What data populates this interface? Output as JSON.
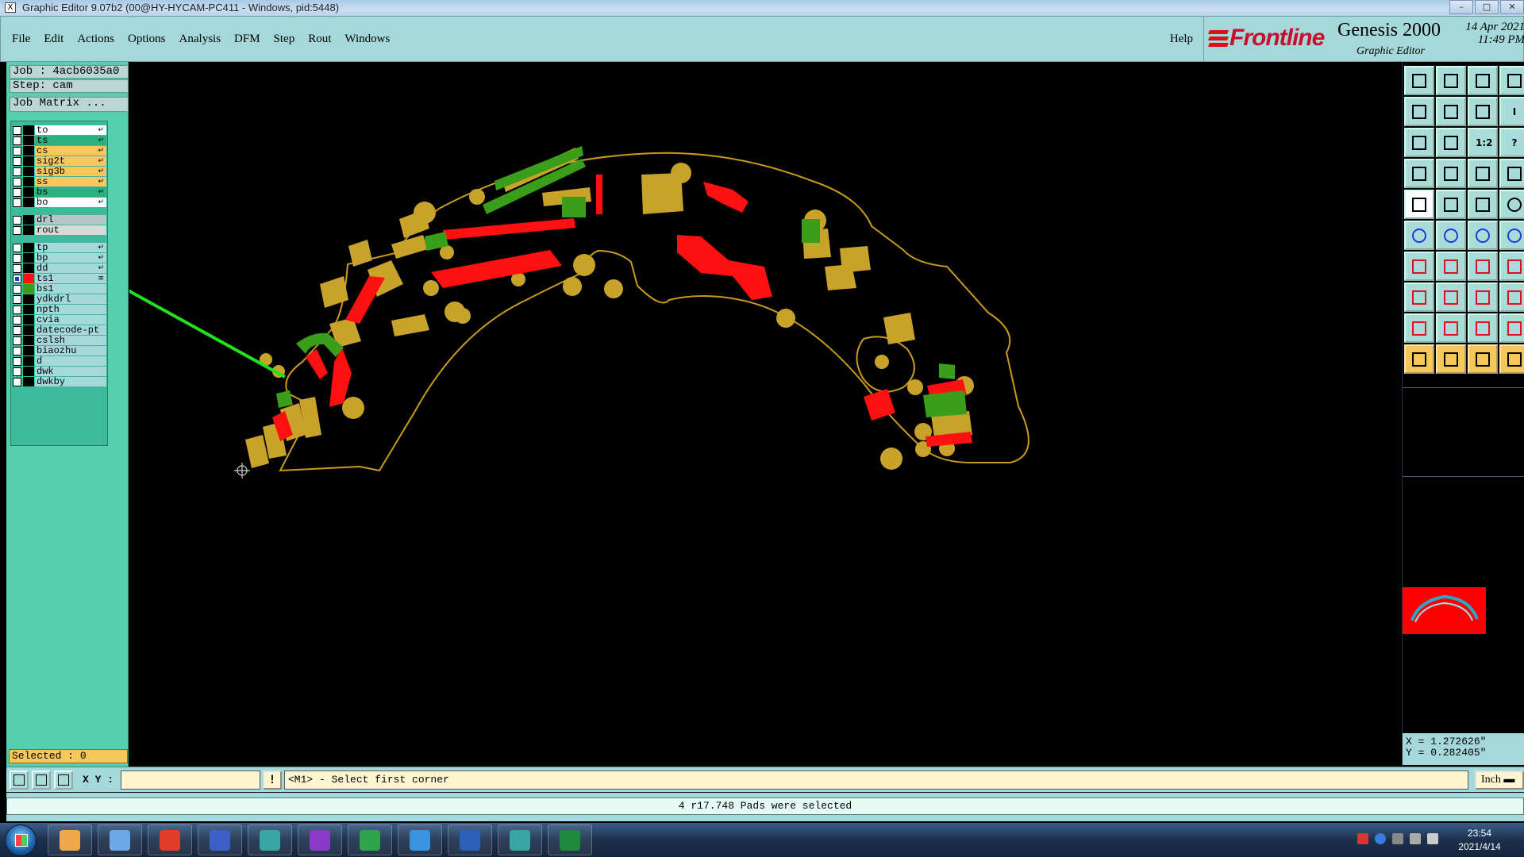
{
  "window": {
    "title": "Graphic Editor 9.07b2 (00@HY-HYCAM-PC411 - Windows, pid:5448)",
    "app_icon": "X",
    "buttons": [
      "–",
      "□",
      "✕"
    ]
  },
  "menu": {
    "items": [
      "File",
      "Edit",
      "Actions",
      "Options",
      "Analysis",
      "DFM",
      "Step",
      "Rout",
      "Windows"
    ],
    "help": "Help"
  },
  "brand": {
    "logo_text": "Frontline",
    "product": "Genesis 2000",
    "subtitle": "Graphic Editor",
    "date": "14 Apr 2021",
    "time": "11:49 PM"
  },
  "left_panel": {
    "job": "Job : 4acb6035a0",
    "step": "Step: cam",
    "job_matrix": "Job Matrix ...",
    "layers": [
      {
        "name": "to",
        "color": "#ffffff",
        "swatch": "#000000",
        "tick": "↵"
      },
      {
        "name": "ts",
        "color": "#2bb07f",
        "swatch": "#000000",
        "tick": "↵"
      },
      {
        "name": "cs",
        "color": "#f6c75a",
        "swatch": "#000000",
        "tick": "↵"
      },
      {
        "name": "sig2t",
        "color": "#f6c75a",
        "swatch": "#000000",
        "tick": "↵"
      },
      {
        "name": "sig3b",
        "color": "#f6c75a",
        "swatch": "#000000",
        "tick": "↵"
      },
      {
        "name": "ss",
        "color": "#f6c75a",
        "swatch": "#000000",
        "tick": "↵"
      },
      {
        "name": "bs",
        "color": "#2bb07f",
        "swatch": "#000000",
        "tick": "↵"
      },
      {
        "name": "bo",
        "color": "#ffffff",
        "swatch": "#000000",
        "tick": "↵"
      },
      {
        "name": "drl",
        "color": "#b9c5c5",
        "swatch": "#000000",
        "tick": ""
      },
      {
        "name": "rout",
        "color": "#d9d9d9",
        "swatch": "#000000",
        "tick": ""
      },
      {
        "name": "tp",
        "color": "#a5d8da",
        "swatch": "#000000",
        "tick": "↵"
      },
      {
        "name": "bp",
        "color": "#a5d8da",
        "swatch": "#000000",
        "tick": "↵"
      },
      {
        "name": "dd",
        "color": "#a5d8da",
        "swatch": "#000000",
        "tick": "↵"
      },
      {
        "name": "ts1",
        "color": "#a5d8da",
        "swatch": "#ff1010",
        "tick": "≡",
        "checked": true
      },
      {
        "name": "bs1",
        "color": "#a5d8da",
        "swatch": "#3a9e1a",
        "tick": ""
      },
      {
        "name": "ydkdrl",
        "color": "#a5d8da",
        "swatch": "#000000",
        "tick": ""
      },
      {
        "name": "npth",
        "color": "#a5d8da",
        "swatch": "#000000",
        "tick": ""
      },
      {
        "name": "cvia",
        "color": "#a5d8da",
        "swatch": "#000000",
        "tick": ""
      },
      {
        "name": "datecode-pt",
        "color": "#a5d8da",
        "swatch": "#000000",
        "tick": ""
      },
      {
        "name": "cslsh",
        "color": "#a5d8da",
        "swatch": "#000000",
        "tick": ""
      },
      {
        "name": "biaozhu",
        "color": "#a5d8da",
        "swatch": "#000000",
        "tick": ""
      },
      {
        "name": "d",
        "color": "#a5d8da",
        "swatch": "#000000",
        "tick": ""
      },
      {
        "name": "dwk",
        "color": "#a5d8da",
        "swatch": "#000000",
        "tick": ""
      },
      {
        "name": "dwkby",
        "color": "#a5d8da",
        "swatch": "#000000",
        "tick": ""
      }
    ],
    "selected": "Selected : 0"
  },
  "canvas": {
    "outline_color": "#c99a1c",
    "pad_color": "#c9a22a",
    "layer_red": "#ff1010",
    "layer_green": "#3a9e1a",
    "arrow_color": "#22e01e"
  },
  "right_panel": {
    "tools": [
      "snapshot-icon",
      "save-view-icon",
      "home-icon",
      "window-icon",
      "pan-left-icon",
      "pan-right-icon",
      "zoom-back-icon",
      "text-icon",
      "fit-icon",
      "zoom-icon",
      "scale-icon",
      "help-icon",
      "draw-icon",
      "line-icon",
      "network-icon",
      "layer-icon",
      "pad-icon",
      "area-icon",
      "measure-icon",
      "circle-icon",
      "select-icon",
      "cross-icon",
      "link-icon",
      "connect-icon",
      "angle-icon",
      "slash-icon",
      "arc-icon",
      "feature-icon",
      "corner-icon",
      "minus-icon",
      "move-icon",
      "group-icon",
      "warning-icon",
      "triangle-icon",
      "outline-icon",
      "shape-icon",
      "pointer-icon",
      "pointer-alt-icon",
      "edit-icon",
      "step-icon"
    ],
    "coords": {
      "x": "X = 1.272626\"",
      "y": "Y = 0.282405\""
    }
  },
  "command_bar": {
    "xy_label": "X Y :",
    "xy_value": "",
    "bang": "!",
    "prompt": "<M1> - Select first corner",
    "units": "Inch ▬"
  },
  "status": {
    "message": "4 r17.748 Pads were selected"
  },
  "taskbar": {
    "apps": [
      {
        "name": "shell-app-icon",
        "color": "#f0a94a"
      },
      {
        "name": "notepad-icon",
        "color": "#6da7e6"
      },
      {
        "name": "red-g-icon",
        "color": "#e03c28"
      },
      {
        "name": "floppy-icon",
        "color": "#3b5fc8"
      },
      {
        "name": "eye-app-icon",
        "color": "#3aa6a2"
      },
      {
        "name": "x-app-icon",
        "color": "#8a3ac8"
      },
      {
        "name": "pen-app-icon",
        "color": "#2fa44a"
      },
      {
        "name": "feather-app-icon",
        "color": "#3a92e0"
      },
      {
        "name": "word-icon",
        "color": "#2b5fb8"
      },
      {
        "name": "eye-app2-icon",
        "color": "#3aa6a2"
      },
      {
        "name": "excel-icon",
        "color": "#1f8a3e"
      }
    ],
    "time": "23:54",
    "date": "2021/4/14"
  }
}
